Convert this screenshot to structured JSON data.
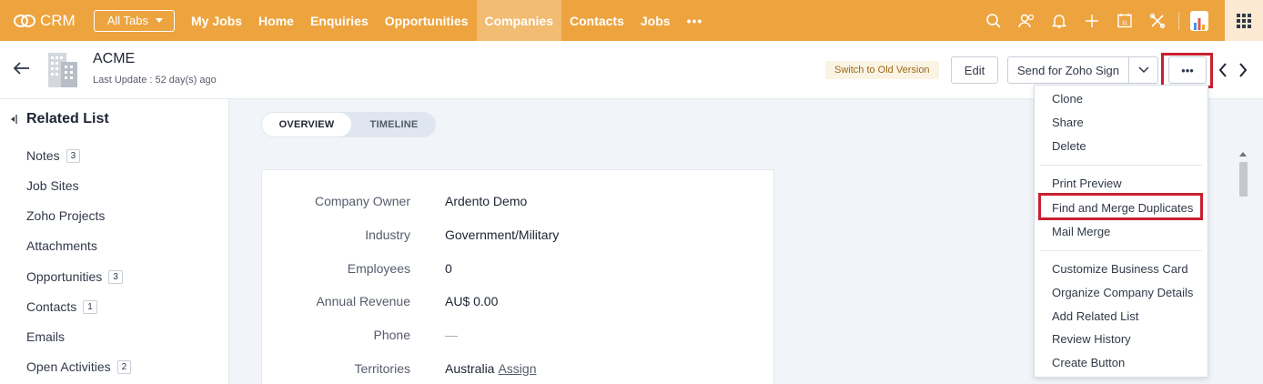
{
  "app": {
    "name": "CRM"
  },
  "nav": {
    "all_tabs": "All Tabs",
    "tabs": [
      "My Jobs",
      "Home",
      "Enquiries",
      "Opportunities",
      "Companies",
      "Contacts",
      "Jobs"
    ],
    "active_tab": "Companies",
    "more": "•••"
  },
  "record": {
    "title": "ACME",
    "last_update": "Last Update : 52 day(s) ago"
  },
  "actions": {
    "old_version": "Switch to Old Version",
    "edit": "Edit",
    "zoho_sign": "Send for Zoho Sign",
    "more": "•••"
  },
  "related_list": {
    "title": "Related List",
    "items": [
      {
        "label": "Notes",
        "count": "3"
      },
      {
        "label": "Job Sites",
        "count": ""
      },
      {
        "label": "Zoho Projects",
        "count": ""
      },
      {
        "label": "Attachments",
        "count": ""
      },
      {
        "label": "Opportunities",
        "count": "3"
      },
      {
        "label": "Contacts",
        "count": "1"
      },
      {
        "label": "Emails",
        "count": ""
      },
      {
        "label": "Open Activities",
        "count": "2"
      }
    ]
  },
  "view_tabs": {
    "overview": "OVERVIEW",
    "timeline": "TIMELINE"
  },
  "fields": [
    {
      "label": "Company Owner",
      "value": "Ardento Demo"
    },
    {
      "label": "Industry",
      "value": "Government/Military"
    },
    {
      "label": "Employees",
      "value": "0"
    },
    {
      "label": "Annual Revenue",
      "value": "AU$ 0.00"
    },
    {
      "label": "Phone",
      "value": "—"
    },
    {
      "label": "Territories",
      "value": "Australia",
      "link": "Assign"
    }
  ],
  "more_menu": {
    "group1": [
      "Clone",
      "Share",
      "Delete"
    ],
    "group2": [
      "Print Preview",
      "Find and Merge Duplicates",
      "Mail Merge"
    ],
    "group3": [
      "Customize Business Card",
      "Organize Company Details",
      "Add Related List",
      "Review History",
      "Create Button"
    ]
  },
  "colors": {
    "nav_bg": "#eda43f",
    "highlight": "#c8202f"
  }
}
